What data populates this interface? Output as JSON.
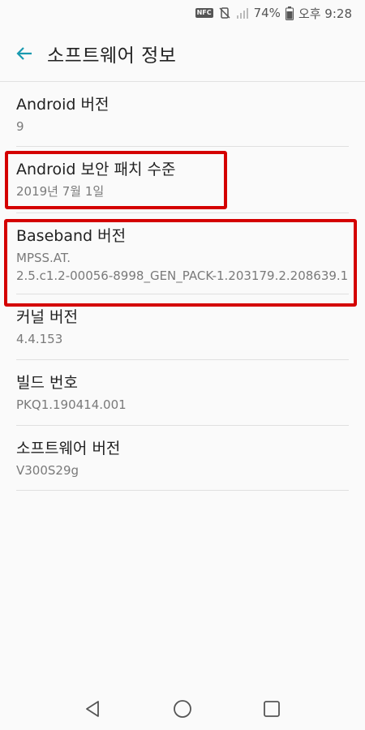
{
  "status_bar": {
    "nfc_label": "NFC",
    "battery": "74%",
    "time": "오후 9:28"
  },
  "header": {
    "back_icon": "arrow-left-icon",
    "title": "소프트웨어 정보"
  },
  "items": [
    {
      "title": "Android 버전",
      "value": [
        "9"
      ]
    },
    {
      "title": "Android 보안 패치 수준",
      "value": [
        "2019년 7월 1일"
      ]
    },
    {
      "title": "Baseband 버전",
      "value": [
        "MPSS.AT.",
        "2.5.c1.2-00056-8998_GEN_PACK-1.203179.2.208639.1"
      ]
    },
    {
      "title": "커널 버전",
      "value": [
        "4.4.153"
      ]
    },
    {
      "title": "빌드 번호",
      "value": [
        "PKQ1.190414.001"
      ]
    },
    {
      "title": "소프트웨어 버전",
      "value": [
        "V300S29g"
      ]
    }
  ],
  "colors": {
    "accent": "#1a9ab0",
    "highlight": "#d40000",
    "background": "#fafafa"
  },
  "nav": {
    "back": "triangle-back-icon",
    "home": "circle-home-icon",
    "recents": "square-recents-icon"
  }
}
